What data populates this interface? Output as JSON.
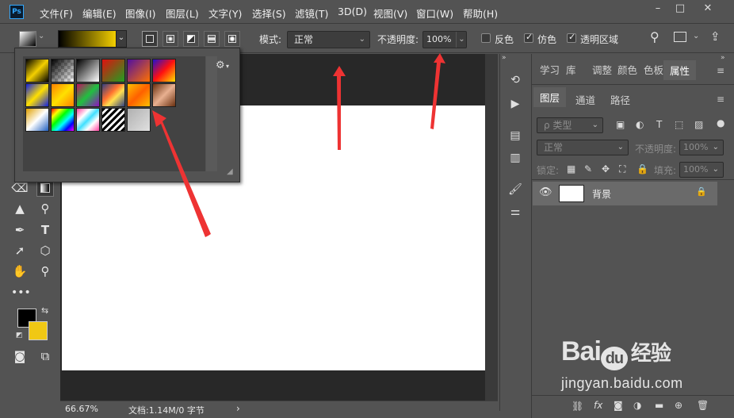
{
  "app": {
    "logo_text": "Ps"
  },
  "menu": [
    "文件(F)",
    "编辑(E)",
    "图像(I)",
    "图层(L)",
    "文字(Y)",
    "选择(S)",
    "滤镜(T)",
    "3D(D)",
    "视图(V)",
    "窗口(W)",
    "帮助(H)"
  ],
  "window_controls": {
    "minimize": "–",
    "maximize": "□",
    "close": "✕"
  },
  "options": {
    "mode_label": "模式:",
    "mode_value": "正常",
    "opacity_label": "不透明度:",
    "opacity_value": "100%",
    "reverse_label": "反色",
    "dither_label": "仿色",
    "transparency_label": "透明区域",
    "reverse_checked": false,
    "dither_checked": true,
    "transparency_checked": true
  },
  "gradient_picker": {
    "gear_icon": "gear-icon",
    "swatches": [
      "linear-gradient(135deg,#000 0%,#f4d000 50%,#000 100%)",
      "linear-gradient(135deg,#000 0%,transparent 100%)",
      "linear-gradient(135deg,#000 0%,#fff 100%)",
      "linear-gradient(135deg,#e01010 0%,#20a020 100%)",
      "linear-gradient(135deg,#5010a0 0%,#ff7000 100%)",
      "linear-gradient(135deg,#2010d0 0%,#ff1010 50%,#ffe000 100%)",
      "linear-gradient(135deg,#1020e0 0%,#ffe000 50%,#1020e0 100%)",
      "linear-gradient(135deg,#ff8000 0%,#ffe000 50%,#ff8000 100%)",
      "linear-gradient(135deg,#c01060 0%,#20c040 50%,#9010c0 100%)",
      "linear-gradient(135deg,#304080 0%,#ff7030 40%,#ffe050 60%,#304080 100%)",
      "linear-gradient(135deg,#ffc000 0%,#ff6000 50%,#ffc000 100%)",
      "linear-gradient(135deg,#6a3010 0%,#e8b090 50%,#6a3010 100%)",
      "linear-gradient(135deg,#e0a000 0%,#ffffff 50%,#2060c0 100%)",
      "linear-gradient(135deg,#ff0000 0%,#ffff00 20%,#00ff00 40%,#00ffff 60%,#0000ff 80%,#ff00ff 100%)",
      "linear-gradient(135deg,#ff40a0 0%,#ffffff 30%,#40e0ff 50%,#ffffff 70%,#ff40a0 100%)",
      "repeating-linear-gradient(135deg,#000 0px,#000 3px,#fff 3px,#fff 6px)",
      "linear-gradient(135deg,#b0b0b0 0%,#e0e0e0 100%)"
    ]
  },
  "toolbar": {
    "expand": "»",
    "foreground_color": "#000000",
    "background_color": "#f0c814"
  },
  "status": {
    "zoom": "66.67%",
    "doc_info": "文档:1.14M/0 字节",
    "arrow": "›"
  },
  "panels": {
    "top_tabs": [
      "学习",
      "库",
      "调整",
      "颜色",
      "色板",
      "属性"
    ],
    "layer_tabs": [
      "图层",
      "通道",
      "路径"
    ],
    "kind_label": "ρ 类型",
    "blend_value": "正常",
    "opacity_label": "不透明度:",
    "opacity_value": "100%",
    "lock_label": "锁定:",
    "fill_label": "填充:",
    "fill_value": "100%",
    "layer_name": "背景"
  },
  "watermark": {
    "brand": "Bai",
    "du": "du",
    "jingyan": "经验",
    "url": "jingyan.baidu.com"
  }
}
